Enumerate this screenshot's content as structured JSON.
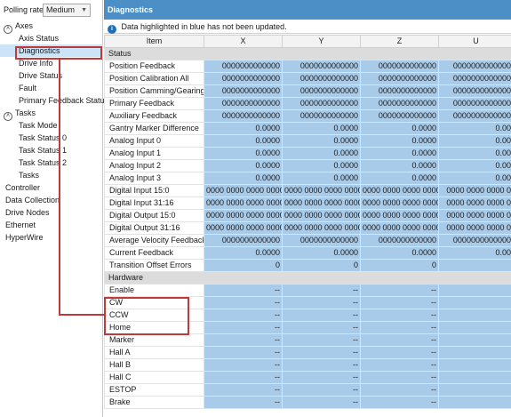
{
  "polling": {
    "label": "Polling rate:",
    "value": "Medium"
  },
  "tree": [
    {
      "label": "Axes",
      "level": 0,
      "collapse": true
    },
    {
      "label": "Axis Status",
      "level": 1
    },
    {
      "label": "Diagnostics",
      "level": 1,
      "selected": true
    },
    {
      "label": "Drive Info",
      "level": 1
    },
    {
      "label": "Drive Status",
      "level": 1
    },
    {
      "label": "Fault",
      "level": 1
    },
    {
      "label": "Primary Feedback Status",
      "level": 1
    },
    {
      "label": "Tasks",
      "level": 0,
      "collapse": true
    },
    {
      "label": "Task Mode",
      "level": 1
    },
    {
      "label": "Task Status 0",
      "level": 1
    },
    {
      "label": "Task Status 1",
      "level": 1
    },
    {
      "label": "Task Status 2",
      "level": 1
    },
    {
      "label": "Tasks",
      "level": 1
    },
    {
      "label": "Controller",
      "level": 0
    },
    {
      "label": "Data Collection",
      "level": 0
    },
    {
      "label": "Drive Nodes",
      "level": 0
    },
    {
      "label": "Ethernet",
      "level": 0
    },
    {
      "label": "HyperWire",
      "level": 0
    }
  ],
  "panel": {
    "title": "Diagnostics",
    "info_icon": "info-icon",
    "info_text": "Data highlighted in blue has not been updated."
  },
  "grid": {
    "columns": [
      "Item",
      "X",
      "Y",
      "Z",
      "U"
    ],
    "rows": [
      {
        "section": "Status"
      },
      {
        "item": "Position Feedback",
        "values": [
          "0000000000000",
          "0000000000000",
          "0000000000000",
          "0000000000000"
        ],
        "hl": true
      },
      {
        "item": "Position Calibration All",
        "values": [
          "0000000000000",
          "0000000000000",
          "0000000000000",
          "0000000000000"
        ],
        "hl": true
      },
      {
        "item": "Position Camming/Gearing",
        "values": [
          "0000000000000",
          "0000000000000",
          "0000000000000",
          "0000000000000"
        ],
        "hl": true
      },
      {
        "item": "Primary Feedback",
        "values": [
          "0000000000000",
          "0000000000000",
          "0000000000000",
          "0000000000000"
        ],
        "hl": true
      },
      {
        "item": "Auxiliary Feedback",
        "values": [
          "0000000000000",
          "0000000000000",
          "0000000000000",
          "0000000000000"
        ],
        "hl": true
      },
      {
        "item": "Gantry Marker Difference",
        "values": [
          "0.0000",
          "0.0000",
          "0.0000",
          "0.00"
        ],
        "hl": true
      },
      {
        "item": "Analog Input 0",
        "values": [
          "0.0000",
          "0.0000",
          "0.0000",
          "0.00"
        ],
        "hl": true
      },
      {
        "item": "Analog Input 1",
        "values": [
          "0.0000",
          "0.0000",
          "0.0000",
          "0.00"
        ],
        "hl": true
      },
      {
        "item": "Analog Input 2",
        "values": [
          "0.0000",
          "0.0000",
          "0.0000",
          "0.00"
        ],
        "hl": true
      },
      {
        "item": "Analog Input 3",
        "values": [
          "0.0000",
          "0.0000",
          "0.0000",
          "0.00"
        ],
        "hl": true
      },
      {
        "item": "Digital Input 15:0",
        "values": [
          "0000 0000 0000 0000",
          "0000 0000 0000 0000",
          "0000 0000 0000 0000",
          "0000 0000 0000 0"
        ],
        "hl": true
      },
      {
        "item": "Digital Input 31:16",
        "values": [
          "0000 0000 0000 0000",
          "0000 0000 0000 0000",
          "0000 0000 0000 0000",
          "0000 0000 0000 0"
        ],
        "hl": true
      },
      {
        "item": "Digital Output 15:0",
        "values": [
          "0000 0000 0000 0000",
          "0000 0000 0000 0000",
          "0000 0000 0000 0000",
          "0000 0000 0000 0"
        ],
        "hl": true
      },
      {
        "item": "Digital Output 31:16",
        "values": [
          "0000 0000 0000 0000",
          "0000 0000 0000 0000",
          "0000 0000 0000 0000",
          "0000 0000 0000 0"
        ],
        "hl": true
      },
      {
        "item": "Average Velocity Feedback",
        "values": [
          "0000000000000",
          "0000000000000",
          "0000000000000",
          "0000000000000"
        ],
        "hl": true
      },
      {
        "item": "Current Feedback",
        "values": [
          "0.0000",
          "0.0000",
          "0.0000",
          "0.00"
        ],
        "hl": true
      },
      {
        "item": "Transition Offset Errors",
        "values": [
          "0",
          "0",
          "0",
          ""
        ],
        "hl": true
      },
      {
        "section": "Hardware"
      },
      {
        "item": "Enable",
        "values": [
          "--",
          "--",
          "--",
          ""
        ],
        "hl": true
      },
      {
        "item": "CW",
        "values": [
          "--",
          "--",
          "--",
          ""
        ],
        "hl": true
      },
      {
        "item": "CCW",
        "values": [
          "--",
          "--",
          "--",
          ""
        ],
        "hl": true
      },
      {
        "item": "Home",
        "values": [
          "--",
          "--",
          "--",
          ""
        ],
        "hl": true
      },
      {
        "item": "Marker",
        "values": [
          "--",
          "--",
          "--",
          ""
        ],
        "hl": true
      },
      {
        "item": "Hall A",
        "values": [
          "--",
          "--",
          "--",
          ""
        ],
        "hl": true
      },
      {
        "item": "Hall B",
        "values": [
          "--",
          "--",
          "--",
          ""
        ],
        "hl": true
      },
      {
        "item": "Hall C",
        "values": [
          "--",
          "--",
          "--",
          ""
        ],
        "hl": true
      },
      {
        "item": "ESTOP",
        "values": [
          "--",
          "--",
          "--",
          ""
        ],
        "hl": true
      },
      {
        "item": "Brake",
        "values": [
          "--",
          "--",
          "--",
          ""
        ],
        "hl": true
      }
    ]
  },
  "colors": {
    "header_bg": "#4b8fc6",
    "not_updated_highlight": "#a9cbea",
    "section_bg": "#dcdcdc",
    "annotation": "#c0393b"
  }
}
